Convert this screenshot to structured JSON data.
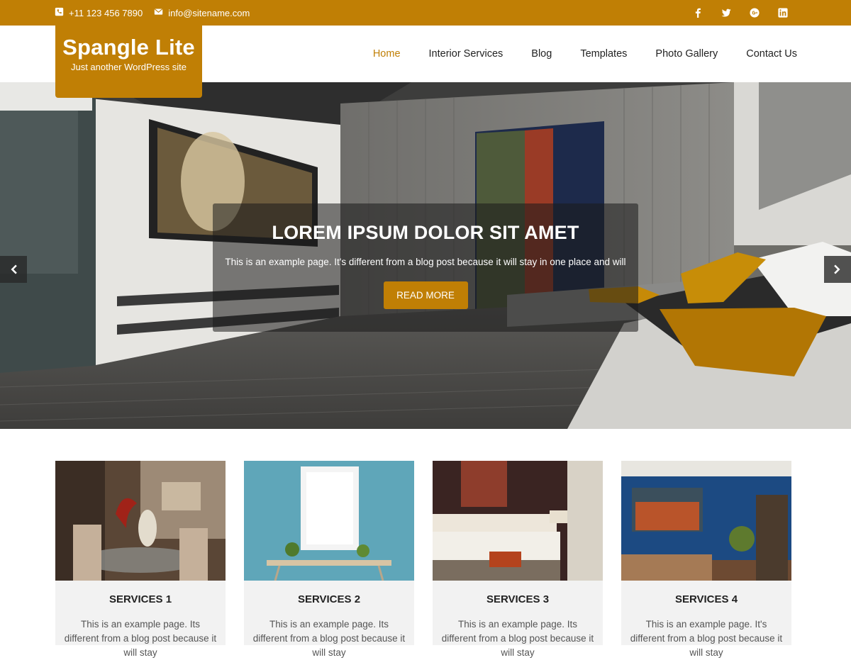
{
  "topbar": {
    "phone": "+11 123 456 7890",
    "email": "info@sitename.com",
    "social": [
      "facebook-icon",
      "twitter-icon",
      "google-plus-icon",
      "linkedin-icon"
    ]
  },
  "site": {
    "name": "Spangle Lite",
    "tagline": "Just another WordPress site"
  },
  "nav": {
    "items": [
      "Home",
      "Interior Services",
      "Blog",
      "Templates",
      "Photo Gallery",
      "Contact Us"
    ],
    "active": "Home"
  },
  "slider": {
    "title": "LOREM IPSUM DOLOR SIT AMET",
    "text": "This is an example page. It's different from a blog post because it will stay in one place and will",
    "button": "READ MORE"
  },
  "services": [
    {
      "title": "SERVICES 1",
      "desc": "This is an example page. Its different from a blog post because it will stay"
    },
    {
      "title": "SERVICES 2",
      "desc": "This is an example page. Its different from a blog post because it will stay"
    },
    {
      "title": "SERVICES 3",
      "desc": "This is an example page. Its different from a blog post because it will stay"
    },
    {
      "title": "SERVICES 4",
      "desc": "This is an example page. It's different from a blog post because it will stay"
    }
  ],
  "colors": {
    "accent": "#c07f05",
    "text": "#222222",
    "card_bg": "#f2f2f2"
  }
}
